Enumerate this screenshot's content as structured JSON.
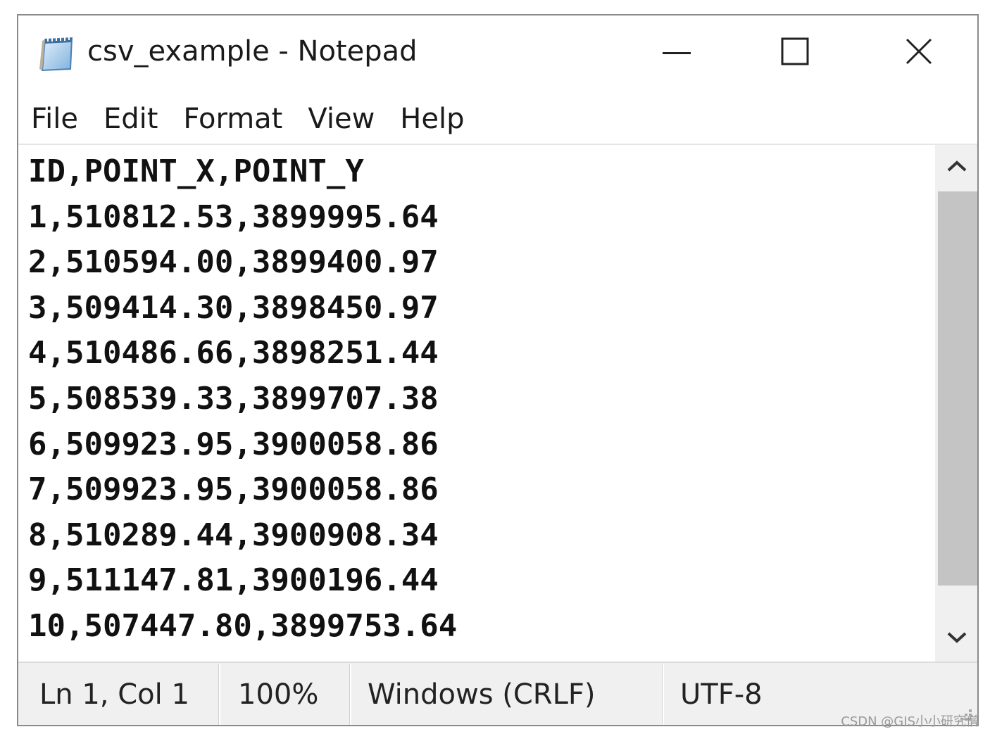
{
  "window": {
    "title": "csv_example - Notepad",
    "app_icon": "notepad-icon",
    "controls": {
      "minimize_icon": "minimize-icon",
      "maximize_icon": "maximize-icon",
      "close_icon": "close-icon"
    }
  },
  "menu": {
    "items": [
      {
        "label": "File"
      },
      {
        "label": "Edit"
      },
      {
        "label": "Format"
      },
      {
        "label": "View"
      },
      {
        "label": "Help"
      }
    ]
  },
  "editor": {
    "lines": [
      "ID,POINT_X,POINT_Y",
      "1,510812.53,3899995.64",
      "2,510594.00,3899400.97",
      "3,509414.30,3898450.97",
      "4,510486.66,3898251.44",
      "5,508539.33,3899707.38",
      "6,509923.95,3900058.86",
      "7,509923.95,3900058.86",
      "8,510289.44,3900908.34",
      "9,511147.81,3900196.44",
      "10,507447.80,3899753.64"
    ],
    "scrollbar": {
      "up_icon": "chevron-up-icon",
      "down_icon": "chevron-down-icon"
    }
  },
  "status": {
    "position": "Ln 1, Col 1",
    "zoom": "100%",
    "line_ending": "Windows (CRLF)",
    "encoding": "UTF-8"
  },
  "watermark": "CSDN @GIS小小研究僧",
  "colors": {
    "status_bar_bg": "#f0f0f0",
    "scroll_thumb": "#c4c4c4",
    "text": "#111111"
  }
}
